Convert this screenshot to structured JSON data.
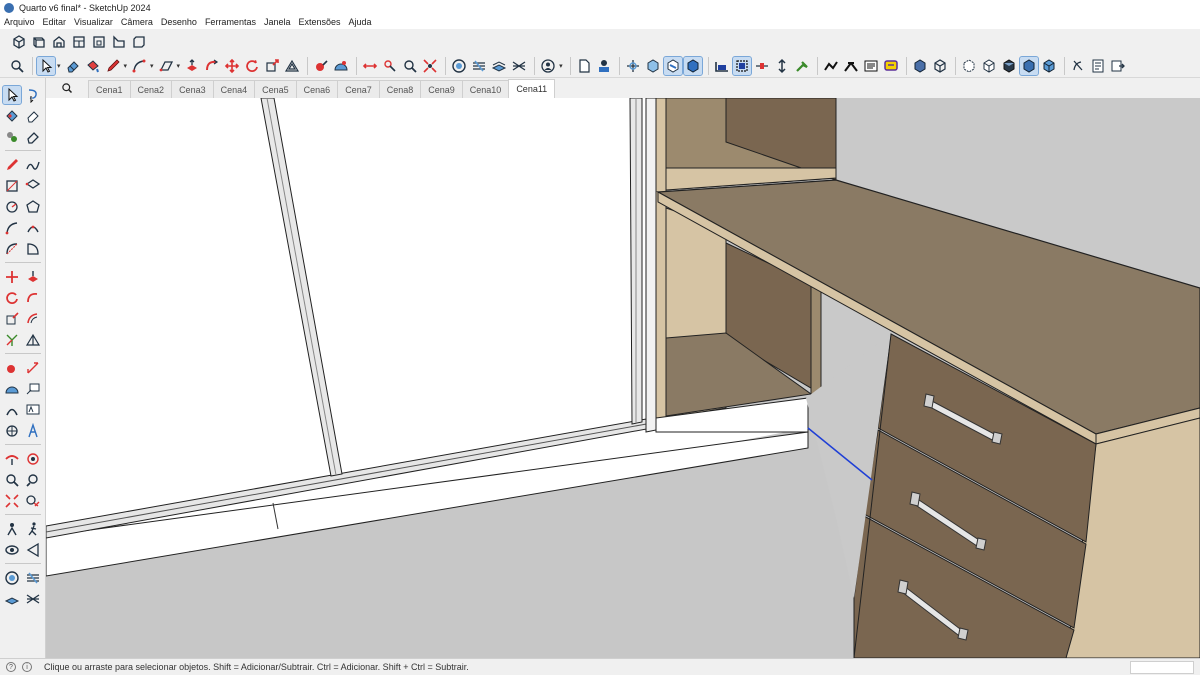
{
  "window": {
    "title": "Quarto v6 final* - SketchUp 2024"
  },
  "menu": [
    "Arquivo",
    "Editar",
    "Visualizar",
    "Câmera",
    "Desenho",
    "Ferramentas",
    "Janela",
    "Extensões",
    "Ajuda"
  ],
  "scene_tabs": [
    "Cena1",
    "Cena2",
    "Cena3",
    "Cena4",
    "Cena5",
    "Cena6",
    "Cena7",
    "Cena8",
    "Cena9",
    "Cena10",
    "Cena11"
  ],
  "active_scene": "Cena11",
  "status": {
    "message": "Clique ou arraste para selecionar objetos. Shift = Adicionar/Subtrair. Ctrl = Adicionar. Shift + Ctrl = Subtrair."
  },
  "colors": {
    "wood_light": "#d6c4a4",
    "wood_dark": "#7a6650",
    "wood_top": "#8a7a64",
    "floor": "#c7c7c7",
    "wall": "#ffffff",
    "axis_blue": "#1f3fd6",
    "accent": "#3a6fb0"
  },
  "icons": {
    "top_row": [
      "iso-view-icon",
      "top-view-icon",
      "front-view-icon",
      "right-view-icon",
      "back-view-icon",
      "left-view-icon",
      "bottom-view-icon"
    ],
    "second_row": [
      "zoom-icon",
      "select-icon",
      "eraser-icon",
      "paint-icon",
      "pencil-icon",
      "arc-icon",
      "rectangle-icon",
      "push-pull-icon",
      "follow-me-icon",
      "move-icon",
      "rotate-icon",
      "scale-icon",
      "offset-icon",
      "tape-icon",
      "protractor-icon",
      "dimension-icon",
      "text-icon",
      "orbit-icon",
      "pan-icon",
      "zoom-window-icon",
      "zoom-extents-icon",
      "sandbox-icon",
      "warehouse-icon",
      "extension-icon",
      "model-info-icon",
      "user-icon",
      "section-plane-icon",
      "section-display-icon",
      "xray-icon",
      "back-edges-icon",
      "wireframe-icon",
      "hidden-line-icon",
      "shaded-icon",
      "textured-icon",
      "monochrome-icon",
      "layout-icon",
      "dynamic-icon",
      "solid-tools-icon",
      "tag-icon",
      "outliner-icon"
    ]
  }
}
